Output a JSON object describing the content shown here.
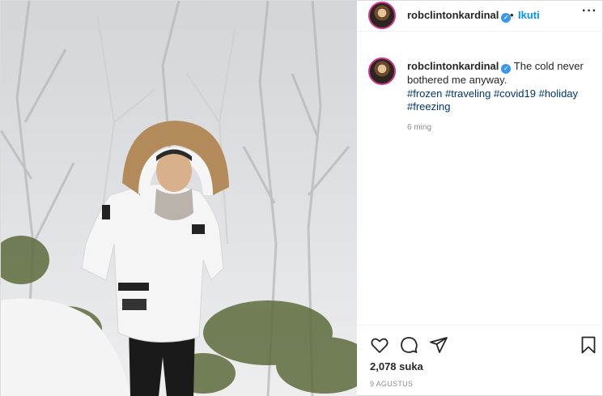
{
  "post": {
    "username": "robclintonkardinal",
    "follow_label": "Ikuti",
    "dot": "•",
    "more": "···",
    "verified_glyph": "✓"
  },
  "caption": {
    "username": "robclintonkardinal",
    "text": "The cold never bothered me anyway.",
    "hashtags": "#frozen #traveling #covid19 #holiday #freezing",
    "time_ago": "6 ming"
  },
  "actions": {
    "icons": [
      "heart-icon",
      "comment-icon",
      "share-icon",
      "bookmark-icon"
    ],
    "likes": "2,078 suka",
    "date": "9 AGUSTUS"
  },
  "colors": {
    "link_blue": "#0095f6",
    "hashtag": "#00376b",
    "verified": "#3897f0",
    "muted": "#8e8e8e"
  }
}
